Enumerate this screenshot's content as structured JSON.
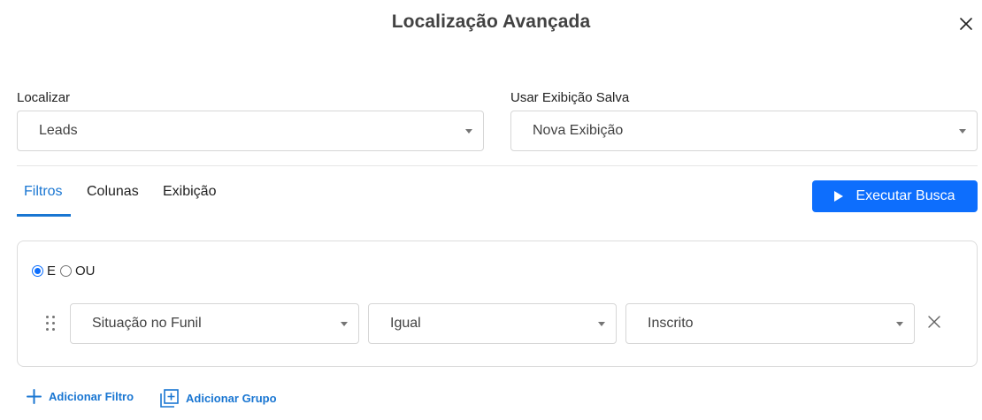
{
  "dialog": {
    "title": "Localização Avançada"
  },
  "find": {
    "label": "Localizar",
    "value": "Leads"
  },
  "saved_view": {
    "label": "Usar Exibição Salva",
    "value": "Nova Exibição"
  },
  "tabs": [
    {
      "label": "Filtros",
      "active": true
    },
    {
      "label": "Colunas",
      "active": false
    },
    {
      "label": "Exibição",
      "active": false
    }
  ],
  "run_button": {
    "label": "Executar Busca"
  },
  "logic": {
    "and_label": "E",
    "or_label": "OU",
    "selected": "E"
  },
  "filter_row": {
    "field": "Situação no Funil",
    "operator": "Igual",
    "value": "Inscrito"
  },
  "actions": {
    "add_filter": "Adicionar Filtro",
    "add_group": "Adicionar Grupo"
  },
  "colors": {
    "accent": "#1976d2",
    "button": "#0d6efd"
  }
}
